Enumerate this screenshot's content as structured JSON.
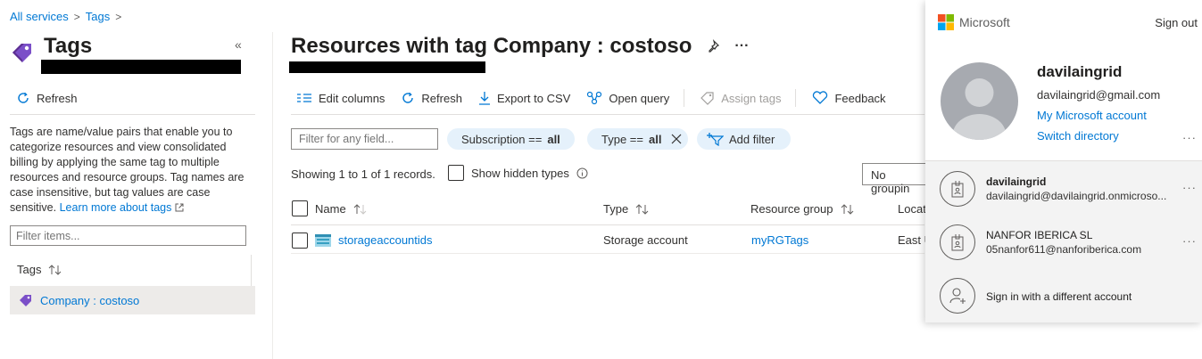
{
  "breadcrumb": {
    "all_services": "All services",
    "sep": ">",
    "tags": "Tags"
  },
  "left": {
    "title": "Tags",
    "collapse_glyph": "«",
    "refresh_label": "Refresh",
    "description": "Tags are name/value pairs that enable you to categorize resources and view consolidated billing by applying the same tag to multiple resources and resource groups. Tag names are case insensitive, but tag values are case sensitive.",
    "learn_more": "Learn more about tags",
    "filter_placeholder": "Filter items...",
    "tags_header": "Tags",
    "tag_item": "Company : costoso"
  },
  "main": {
    "title": "Resources with tag Company : costoso",
    "more_glyph": "···",
    "toolbar": {
      "edit_columns": "Edit columns",
      "refresh": "Refresh",
      "export_csv": "Export to CSV",
      "open_query": "Open query",
      "assign_tags": "Assign tags",
      "feedback": "Feedback"
    },
    "filter_placeholder": "Filter for any field...",
    "pills": {
      "subscription_label": "Subscription ==",
      "subscription_value": "all",
      "type_label": "Type ==",
      "type_value": "all",
      "add_filter": "Add filter"
    },
    "records_text": "Showing 1 to 1 of 1 records.",
    "show_hidden": "Show hidden types",
    "grouping": "No groupin",
    "columns": [
      "Name",
      "Type",
      "Resource group",
      "Locat"
    ],
    "rows": [
      {
        "name": "storageaccountids",
        "type": "Storage account",
        "resource_group": "myRGTags",
        "location": "East U"
      }
    ]
  },
  "account": {
    "brand": "Microsoft",
    "sign_out": "Sign out",
    "name": "davilaingrid",
    "email": "davilaingrid@gmail.com",
    "my_account": "My Microsoft account",
    "switch_directory": "Switch directory",
    "more_glyph": "···",
    "others": [
      {
        "name": "davilaingrid",
        "email": "davilaingrid@davilaingrid.onmicroso..."
      },
      {
        "name": "NANFOR IBERICA SL",
        "email": "05nanfor611@nanforiberica.com"
      }
    ],
    "sign_in_different": "Sign in with a different account"
  },
  "colors": {
    "link": "#0078d4",
    "pill": "#e5f1fb",
    "tag_icon": "#7b4fc8",
    "selected_row": "#edebe9"
  }
}
